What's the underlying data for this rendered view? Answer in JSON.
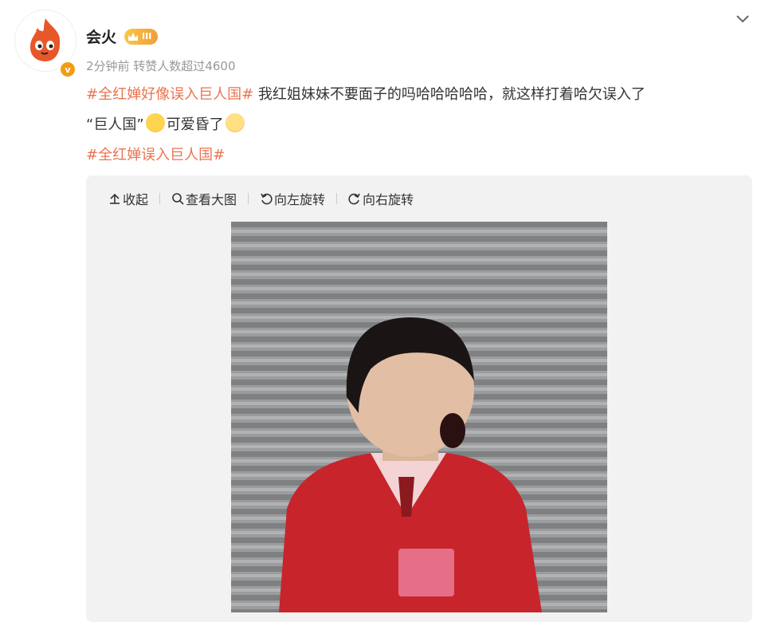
{
  "user": {
    "name": "会火",
    "level_badge": "III",
    "verified": "v"
  },
  "post": {
    "meta": "2分钟前 转赞人数超过4600",
    "tag1": "#全红婵好像误入巨人国#",
    "text1": " 我红姐妹妹不要面子的吗哈哈哈哈哈，就这样打着哈欠误入了",
    "text2": "“巨人国”",
    "text3": "可爱昏了",
    "tag2": "#全红婵误入巨人国#"
  },
  "toolbar": {
    "collapse": "收起",
    "view_large": "查看大图",
    "rotate_left": "向左旋转",
    "rotate_right": "向右旋转"
  },
  "colors": {
    "tag": "#eb7350",
    "meta": "#999999",
    "media_bg": "#f2f2f2"
  }
}
